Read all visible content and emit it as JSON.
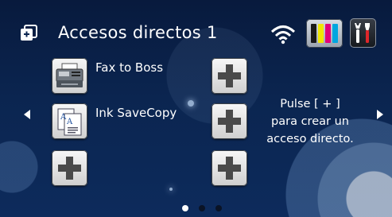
{
  "header": {
    "title": "Accesos directos 1",
    "icons": [
      "shortcut-menu-icon",
      "wifi-icon",
      "ink-icon",
      "tools-icon"
    ],
    "ink_colors": [
      "#1a1a1a",
      "#f0e600",
      "#e2007a",
      "#00a6e0"
    ]
  },
  "shortcuts": [
    {
      "label": "Fax to Boss",
      "icon": "fax-icon"
    },
    {
      "label": "Ink SaveCopy",
      "icon": "copy-icon"
    }
  ],
  "info_text": [
    "Pulse [ + ]",
    "para crear un",
    "acceso directo."
  ],
  "pagination": {
    "pages": 3,
    "current": 1
  },
  "colors": {
    "accent_plus": "#4a4a4a",
    "background": "#0b2550"
  }
}
